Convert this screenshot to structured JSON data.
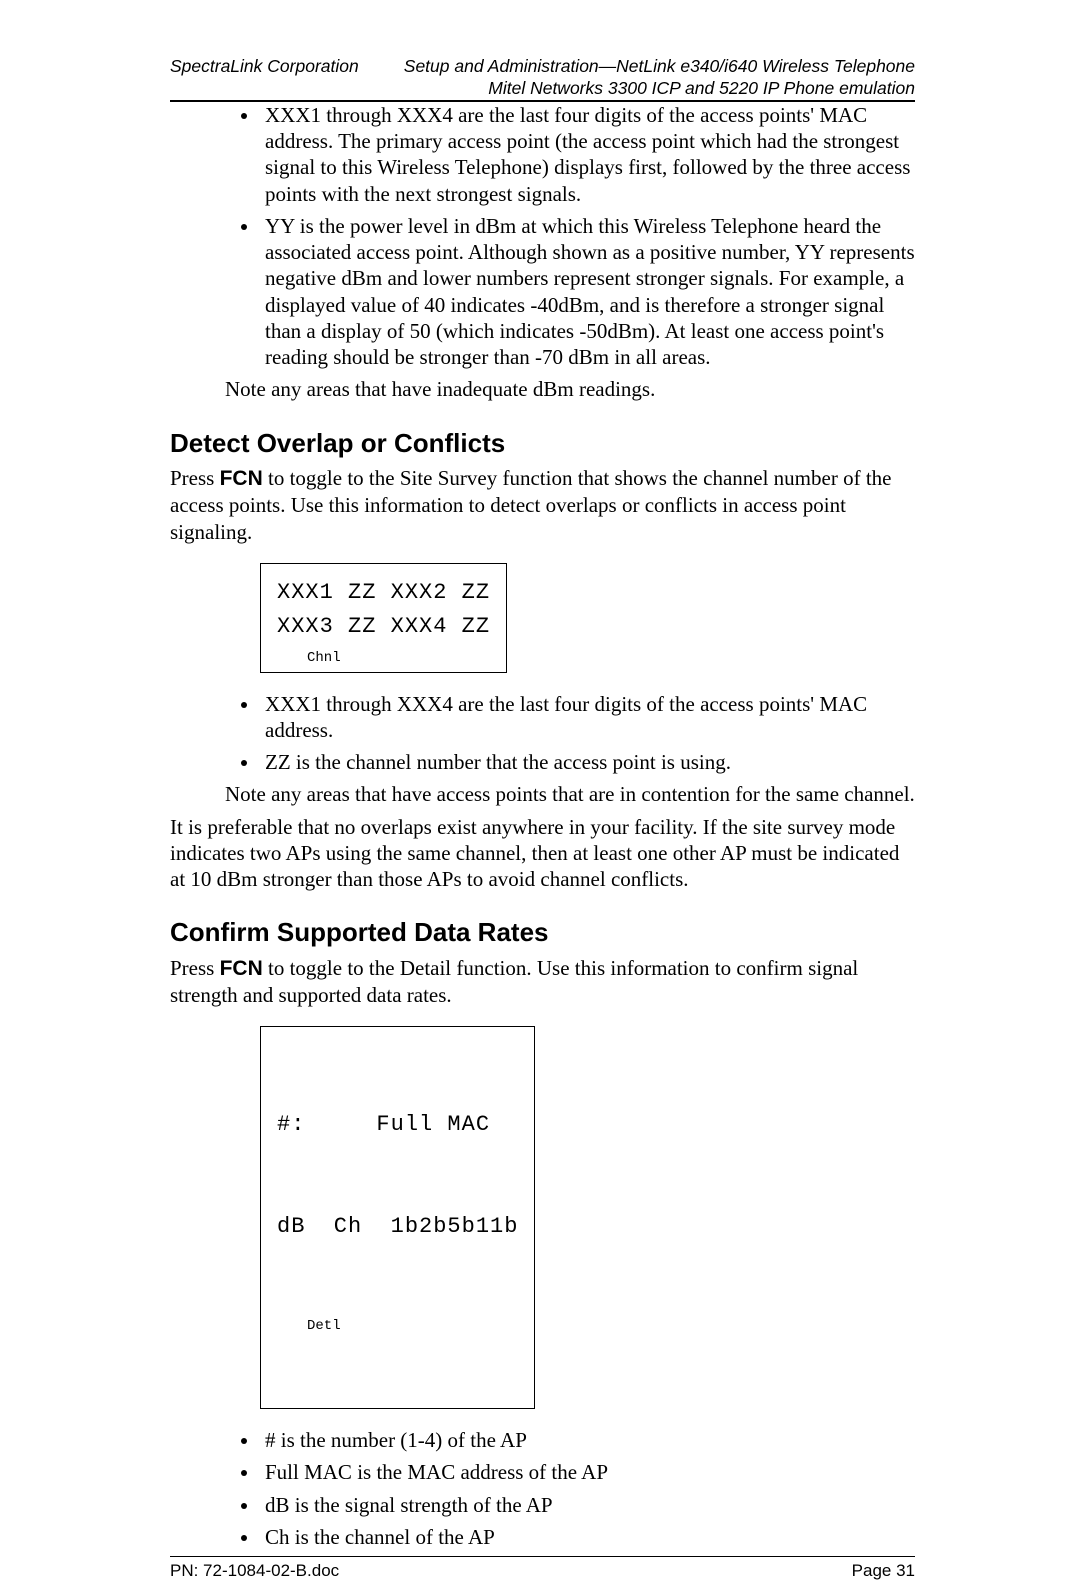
{
  "header": {
    "left": "SpectraLink Corporation",
    "right_line1": "Setup and Administration—NetLink e340/i640 Wireless Telephone",
    "right_line2": "Mitel Networks 3300 ICP and 5220 IP Phone emulation"
  },
  "bullets_top": [
    "XXX1 through XXX4 are the last four digits of the access points' MAC address. The primary access point (the access point which had the strongest signal to this Wireless Telephone) displays first, followed by the three access points with the next strongest signals.",
    "YY is the power level in dBm at which this Wireless Telephone heard the associated access point. Although shown as a positive number, YY represents negative dBm and lower numbers represent stronger signals. For example, a displayed value of 40 indicates -40dBm, and is therefore a stronger signal than a display of 50 (which indicates -50dBm). At least one access point's reading should be stronger than -70 dBm in all areas."
  ],
  "note_top": "Note any areas that have inadequate dBm readings.",
  "section1": {
    "title": "Detect Overlap or Conflicts",
    "intro_pre": "Press ",
    "intro_fcn": "FCN",
    "intro_post": " to toggle to the Site Survey function that shows the channel number of the access points. Use this information to detect overlaps or conflicts in access point signaling.",
    "display": {
      "line1": "XXX1 ZZ XXX2 ZZ",
      "line2": "XXX3 ZZ XXX4 ZZ",
      "label": "Chnl"
    },
    "bullets": [
      "XXX1 through XXX4 are the last four digits of the access points' MAC address.",
      "ZZ is the channel number that the access point is using."
    ],
    "note": "Note any areas that have access points that are in contention for the same channel.",
    "closing": "It is preferable that no overlaps exist anywhere in your facility. If the site survey mode indicates two APs using the same channel, then at least one other AP must be indicated at 10 dBm stronger than those APs to avoid channel conflicts."
  },
  "section2": {
    "title": "Confirm Supported Data Rates",
    "intro_pre": "Press ",
    "intro_fcn": "FCN",
    "intro_post": " to toggle to the Detail function. Use this information to confirm signal strength and supported data rates.",
    "display": {
      "line1": "#:     Full MAC",
      "line2": "dB  Ch  1b2b5b11b",
      "label": "Detl"
    },
    "bullets": [
      "# is the number (1-4) of the AP",
      "Full MAC is the MAC address of the AP",
      "dB is the signal strength of the AP",
      "Ch is the channel of the AP"
    ]
  },
  "footer": {
    "left": "PN: 72-1084-02-B.doc",
    "right": "Page 31"
  }
}
